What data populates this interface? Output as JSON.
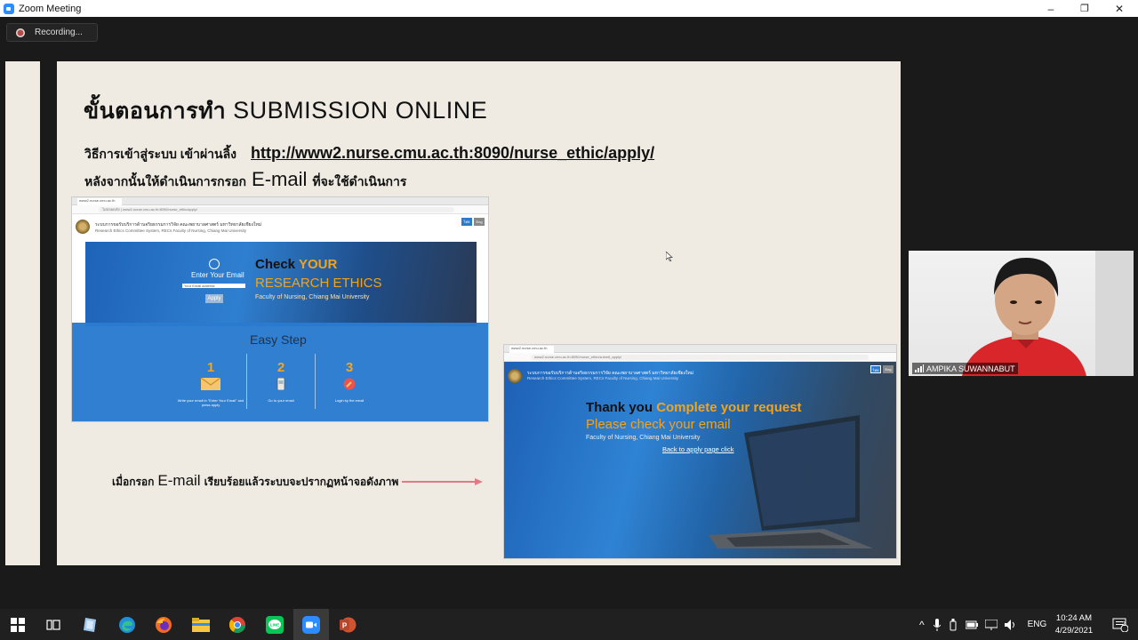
{
  "window": {
    "title": "Zoom Meeting",
    "minimize_glyph": "–",
    "maximize_glyph": "❐",
    "close_glyph": "✕"
  },
  "recording": {
    "label": "Recording..."
  },
  "slide": {
    "title_thai": "ขั้นตอนการทำ",
    "title_en": "SUBMISSION ONLINE",
    "line1_thai": "วิธีการเข้าสู่ระบบ  เข้าผ่านลิ้ง",
    "line1_url": "http://www2.nurse.cmu.ac.th:8090/nurse_ethic/apply/",
    "line2_thai_a": "หลังจากนั้นให้ดำเนินการกรอก",
    "line2_email": "E-mail",
    "line2_thai_b": "ที่จะใช้ดำเนินการ",
    "note_thai_a": "เมื่อกรอก",
    "note_email": "E-mail",
    "note_thai_b": "เรียบร้อยแล้วระบบจะปรากฏหน้าจอดังภาพ"
  },
  "screenshot1": {
    "tab": "www2.nurse.cmu.ac.th",
    "address": "ไม่ปลอดภัย | www2.nurse.cmu.ac.th:8090/nurse_ethic/apply/",
    "site_title": "ระบบการขอรับบริการด้านจริยธรรมการวิจัย คณะพยาบาลศาสตร์ มหาวิทยาลัยเชียงใหม่",
    "site_subtitle": "Research Ethics Committee System, RECs Faculty of Nursing, Chiang Mai University",
    "lang_th": "ไทย",
    "lang_en": "Eng",
    "enter_email": "Enter Your Email",
    "email_placeholder": "Your Email address",
    "apply": "Apply",
    "hero_check": "Check",
    "hero_your": "YOUR",
    "hero_research": "RESEARCH ETHICS",
    "hero_faculty": "Faculty of Nursing, Chiang Mai University",
    "easy_step": "Easy Step",
    "steps": [
      {
        "num": "1",
        "caption": "Write your email in \"Enter Your Email\" and press apply"
      },
      {
        "num": "2",
        "caption": "Go to your email"
      },
      {
        "num": "3",
        "caption": "Login by the email"
      }
    ]
  },
  "screenshot2": {
    "tab": "www2.nurse.cmu.ac.th",
    "address": "www2.nurse.cmu.ac.th:8090/nurse_ethic/submit_apply/",
    "site_title": "ระบบการขอรับบริการด้านจริยธรรมการวิจัย คณะพยาบาลศาสตร์ มหาวิทยาลัยเชียงใหม่",
    "site_subtitle": "Research Ethics Committee System, RECs Faculty of Nursing, Chiang Mai University",
    "lang_th": "ไทย",
    "lang_en": "Eng",
    "thank_you": "Thank you",
    "complete": "Complete your request",
    "check_email": "Please check your email",
    "faculty": "Faculty of Nursing, Chiang Mai University",
    "back_link": "Back to apply page click"
  },
  "video": {
    "participant_name": "AMPIKA SUWANNABUT"
  },
  "taskbar": {
    "apps": [
      "windows-start",
      "task-view",
      "file-app",
      "edge",
      "firefox",
      "file-explorer",
      "chrome",
      "line",
      "zoom",
      "powerpoint"
    ],
    "lang": "ENG",
    "time": "10:24 AM",
    "date": "4/29/2021",
    "notifications": "2"
  },
  "colors": {
    "accent_orange": "#f2a31d",
    "hero_blue": "#2a7bd0",
    "slide_bg": "#efebe3",
    "arrow_pink": "#e07a86"
  }
}
